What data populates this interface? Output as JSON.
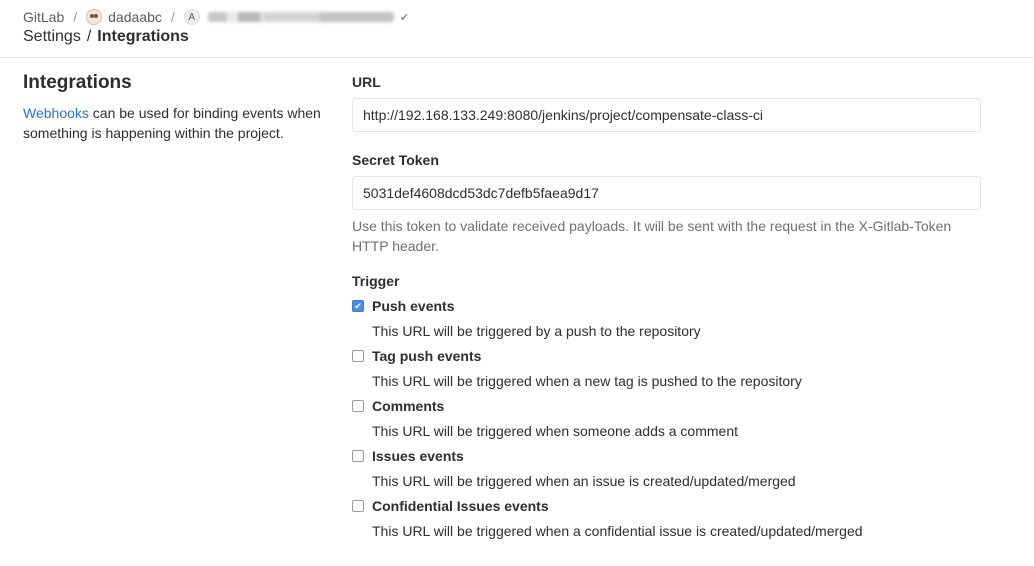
{
  "breadcrumb": {
    "root": "GitLab",
    "group": "dadaabc",
    "project_initial": "A"
  },
  "title_crumb": {
    "parent": "Settings",
    "current": "Integrations"
  },
  "sidebar": {
    "heading": "Integrations",
    "link_text": "Webhooks",
    "description_rest": " can be used for binding events when something is happening within the project."
  },
  "form": {
    "url_label": "URL",
    "url_value": "http://192.168.133.249:8080/jenkins/project/compensate-class-ci",
    "token_label": "Secret Token",
    "token_value": "5031def4608dcd53dc7defb5faea9d17",
    "token_help": "Use this token to validate received payloads. It will be sent with the request in the X-Gitlab-Token HTTP header.",
    "trigger_label": "Trigger"
  },
  "triggers": [
    {
      "name": "Push events",
      "checked": true,
      "description": "This URL will be triggered by a push to the repository"
    },
    {
      "name": "Tag push events",
      "checked": false,
      "description": "This URL will be triggered when a new tag is pushed to the repository"
    },
    {
      "name": "Comments",
      "checked": false,
      "description": "This URL will be triggered when someone adds a comment"
    },
    {
      "name": "Issues events",
      "checked": false,
      "description": "This URL will be triggered when an issue is created/updated/merged"
    },
    {
      "name": "Confidential Issues events",
      "checked": false,
      "description": "This URL will be triggered when a confidential issue is created/updated/merged"
    }
  ],
  "colors": {
    "link": "#1f78d1",
    "checkbox_checked": "#4a90e2"
  }
}
